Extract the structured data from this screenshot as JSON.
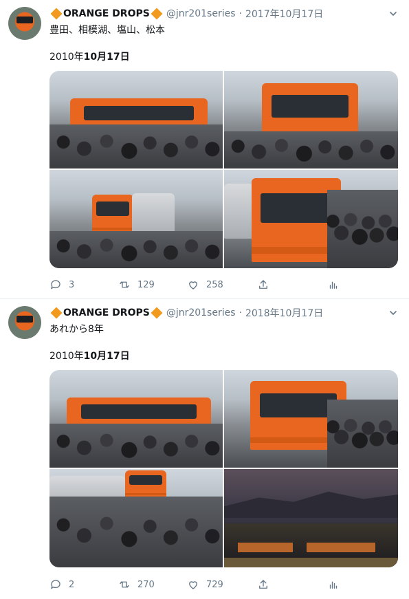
{
  "tweets": [
    {
      "display_name": "ORANGE DROPS",
      "handle": "@jnr201series",
      "separator": "·",
      "date": "2017年10月17日",
      "text": "豊田、相模湖、塩山、松本",
      "caption_prefix": "2010年",
      "caption_bold": "10月17日",
      "replies": "3",
      "retweets": "129",
      "likes": "258"
    },
    {
      "display_name": "ORANGE DROPS",
      "handle": "@jnr201series",
      "separator": "·",
      "date": "2018年10月17日",
      "text": "あれから8年",
      "caption_prefix": "2010年",
      "caption_bold": "10月17日",
      "replies": "2",
      "retweets": "270",
      "likes": "729"
    }
  ],
  "icons": {
    "brand_diamond_color": "#f29a1d",
    "action_color": "#657786",
    "names": [
      "reply-icon",
      "retweet-icon",
      "like-icon",
      "share-icon",
      "analytics-icon",
      "chevron-down-icon"
    ]
  }
}
